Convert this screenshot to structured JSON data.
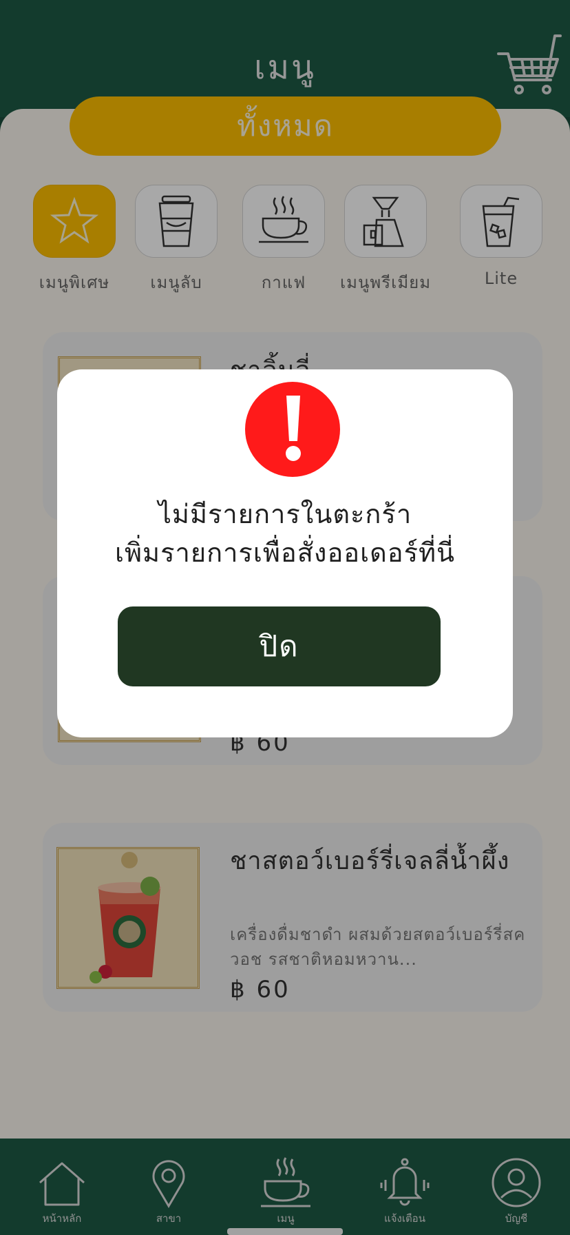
{
  "header": {
    "title": "เมนู",
    "cart_icon": "shopping-cart-icon"
  },
  "filter": {
    "all_label": "ทั้งหมด"
  },
  "categories": [
    {
      "label": "เมนูพิเศษ",
      "icon": "star-icon",
      "active": true
    },
    {
      "label": "เมนูลับ",
      "icon": "takeaway-cup-icon",
      "active": false
    },
    {
      "label": "กาแฟ",
      "icon": "coffee-cup-icon",
      "active": false
    },
    {
      "label": "เมนูพรีเมียม",
      "icon": "drip-coffee-icon",
      "active": false
    },
    {
      "label": "Lite",
      "icon": "iced-drink-icon",
      "active": false
    }
  ],
  "menu_items": [
    {
      "name": "ชาลิ้นจี่",
      "description": "",
      "price": ""
    },
    {
      "name": "",
      "description": "",
      "price": "฿ 60"
    },
    {
      "name": "ชาสตอว์เบอร์รี่เจลลี่น้ำผึ้ง",
      "description": "เครื่องดื่มชาดำ ผสมด้วยสตอว์เบอร์รี่สควอช รสชาติหอมหวาน...",
      "price": "฿ 60"
    }
  ],
  "modal": {
    "icon": "alert-icon",
    "message_line1": "ไม่มีรายการในตะกร้า",
    "message_line2": "เพิ่มรายการเพื่อสั่งออเดอร์ที่นี่",
    "close_label": "ปิด"
  },
  "bottom_nav": [
    {
      "label": "หน้าหลัก",
      "icon": "home-icon"
    },
    {
      "label": "สาขา",
      "icon": "location-pin-icon"
    },
    {
      "label": "เมนู",
      "icon": "coffee-cup-icon"
    },
    {
      "label": "แจ้งเตือน",
      "icon": "bell-icon"
    },
    {
      "label": "บัญชี",
      "icon": "user-icon"
    }
  ],
  "colors": {
    "brand_green": "#1d5a45",
    "accent_yellow": "#ffc000",
    "alert_red": "#ff1a1a",
    "button_dark": "#203722"
  }
}
